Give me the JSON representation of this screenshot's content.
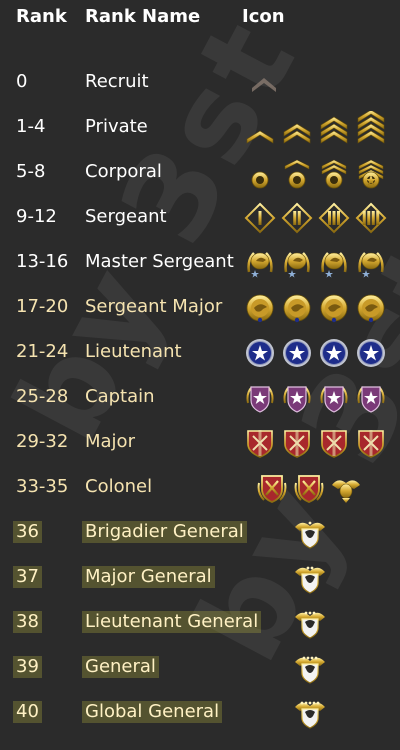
{
  "header": {
    "rank": "Rank",
    "name": "Rank Name",
    "icon": "Icon"
  },
  "watermark": "by 3st",
  "colors": {
    "background": "#2b2b2b",
    "gold": "#d4a830",
    "gold_dark": "#8a6a10",
    "blue": "#1e2d8a",
    "purple": "#7a3a78",
    "red": "#a8282c",
    "highlight": "#bebb3c"
  },
  "ranks": [
    {
      "rank": "0",
      "name": "Recruit",
      "style": "white",
      "icon_style": "recruit-chevron",
      "icon_count": 1
    },
    {
      "rank": "1-4",
      "name": "Private",
      "style": "white",
      "icon_style": "gold-chevrons",
      "icon_count": 4
    },
    {
      "rank": "5-8",
      "name": "Corporal",
      "style": "white",
      "icon_style": "gold-chevron-circles",
      "icon_count": 4
    },
    {
      "rank": "9-12",
      "name": "Sergeant",
      "style": "white",
      "icon_style": "roman-diamonds",
      "icon_count": 4
    },
    {
      "rank": "13-16",
      "name": "Master Sergeant",
      "style": "white",
      "icon_style": "eagle-star-wreath",
      "icon_count": 4
    },
    {
      "rank": "17-20",
      "name": "Sergeant Major",
      "style": "gold",
      "icon_style": "eagle-medallion",
      "icon_count": 4
    },
    {
      "rank": "21-24",
      "name": "Lieutenant",
      "style": "gold",
      "icon_style": "blue-star-medallion",
      "icon_count": 4
    },
    {
      "rank": "25-28",
      "name": "Captain",
      "style": "gold",
      "icon_style": "purple-star-shield",
      "icon_count": 4
    },
    {
      "rank": "29-32",
      "name": "Major",
      "style": "gold",
      "icon_style": "crimson-sword-shield",
      "icon_count": 4
    },
    {
      "rank": "33-35",
      "name": "Colonel",
      "style": "gold",
      "icon_style": "red-shield-eagle",
      "icon_count": 3
    },
    {
      "rank": "36",
      "name": "Brigadier General",
      "style": "hl",
      "icon_style": "winged-eagle-1",
      "icon_count": 1
    },
    {
      "rank": "37",
      "name": "Major General",
      "style": "hl",
      "icon_style": "winged-eagle-2",
      "icon_count": 1
    },
    {
      "rank": "38",
      "name": "Lieutenant General",
      "style": "hl",
      "icon_style": "winged-eagle-3",
      "icon_count": 1
    },
    {
      "rank": "39",
      "name": "General",
      "style": "hl",
      "icon_style": "winged-eagle-4",
      "icon_count": 1
    },
    {
      "rank": "40",
      "name": "Global General",
      "style": "hl",
      "icon_style": "winged-eagle-5",
      "icon_count": 1
    }
  ]
}
